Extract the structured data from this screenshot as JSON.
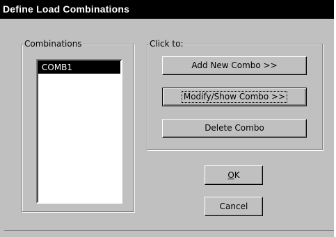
{
  "window": {
    "title": "Define Load Combinations"
  },
  "combinations": {
    "caption": "Combinations",
    "items": [
      "COMB1"
    ],
    "selected": "COMB1"
  },
  "actions": {
    "caption": "Click to:",
    "add_label": "Add New Combo >>",
    "modify_label": "Modify/Show Combo >>",
    "delete_label": "Delete Combo"
  },
  "dialog_buttons": {
    "ok_mnemonic": "O",
    "ok_rest": "K",
    "cancel_label": "Cancel"
  }
}
